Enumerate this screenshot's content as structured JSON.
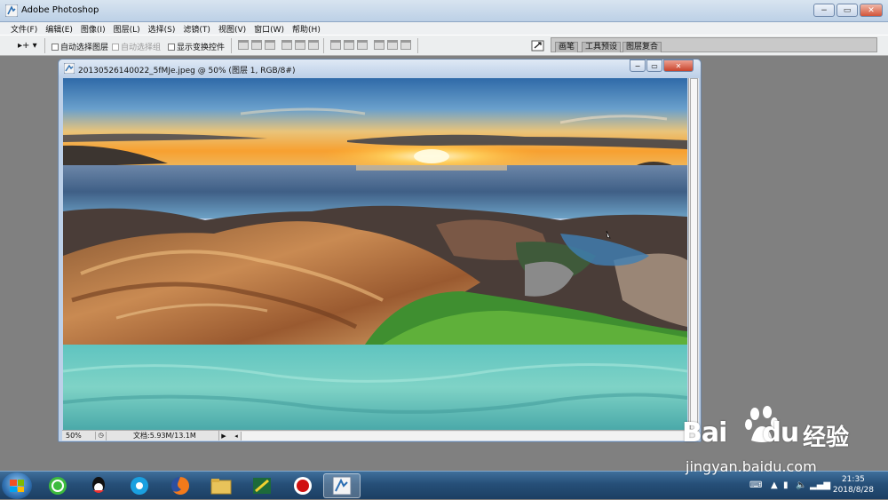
{
  "app": {
    "title": "Adobe Photoshop",
    "window_buttons": {
      "minimize": "−",
      "restore": "▭",
      "close": "✕"
    }
  },
  "menubar": {
    "items": [
      "文件(F)",
      "编辑(E)",
      "图像(I)",
      "图层(L)",
      "选择(S)",
      "滤镜(T)",
      "视图(V)",
      "窗口(W)",
      "帮助(H)"
    ]
  },
  "options_bar": {
    "tool_arrow": "▸+ ▾",
    "auto_select_layer": "自动选择图层",
    "auto_select_group": "自动选择组",
    "show_transform_controls": "显示变换控件"
  },
  "palette_well": {
    "tabs": [
      "画笔",
      "工具预设",
      "图层复合"
    ]
  },
  "document": {
    "title": "20130526140022_5fMJe.jpeg @ 50% (图层 1, RGB/8#)",
    "zoom": "50%",
    "doc_size": "文档:5.93M/13.1M"
  },
  "taskbar": {
    "clock_time": "21:35",
    "clock_date": "2018/8/28"
  },
  "watermark": {
    "brand": "Bai",
    "brand_suffix": "du",
    "cn": "经验",
    "url": "jingyan.baidu.com"
  },
  "colors": {
    "accent": "#3a6ea5",
    "titlebar": "#bcd0e6",
    "workspace": "#808080"
  }
}
